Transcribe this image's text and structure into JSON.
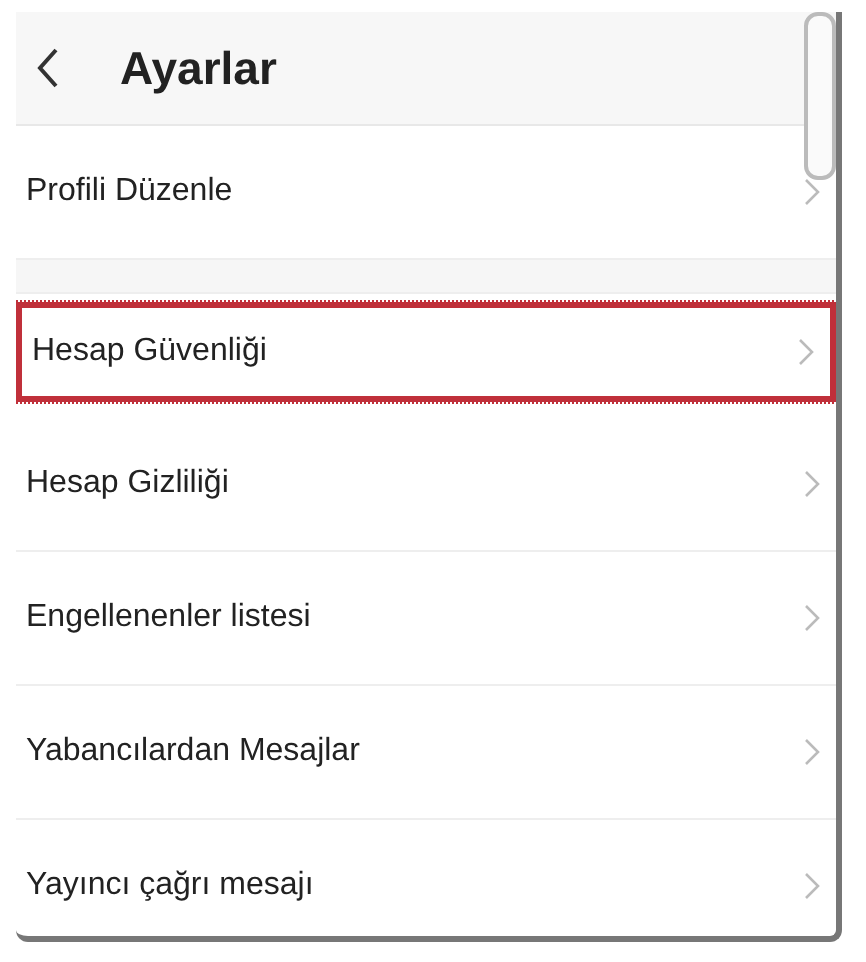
{
  "header": {
    "title": "Ayarlar"
  },
  "sections": [
    {
      "items": [
        {
          "label": "Profili Düzenle",
          "highlighted": false
        }
      ]
    },
    {
      "items": [
        {
          "label": "Hesap Güvenliği",
          "highlighted": true
        },
        {
          "label": "Hesap Gizliliği",
          "highlighted": false
        },
        {
          "label": "Engellenenler listesi",
          "highlighted": false
        },
        {
          "label": "Yabancılardan Mesajlar",
          "highlighted": false
        },
        {
          "label": "Yayıncı çağrı mesajı",
          "highlighted": false
        }
      ]
    }
  ]
}
